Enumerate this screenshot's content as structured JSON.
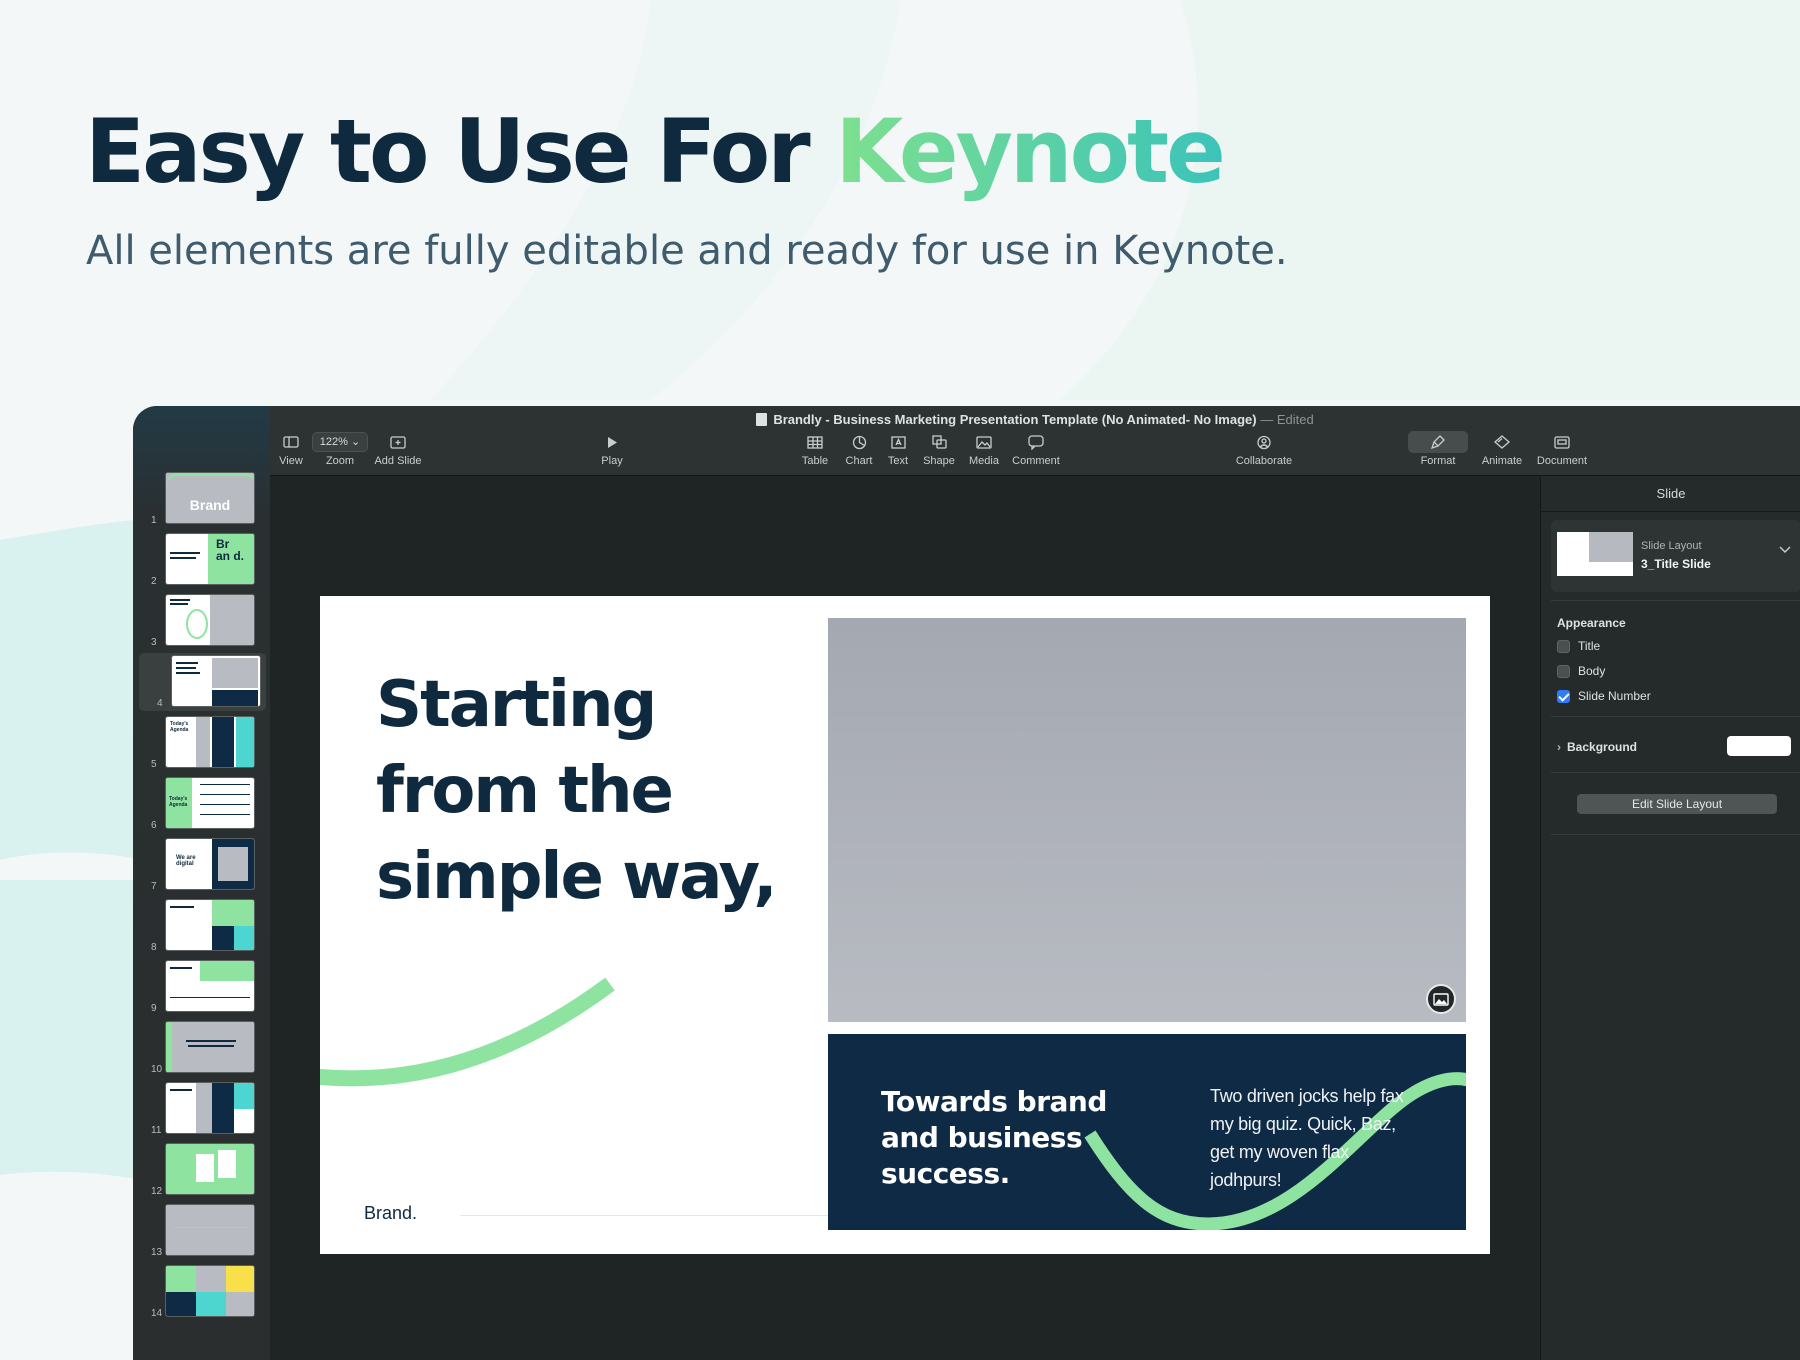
{
  "hero": {
    "title_main": "Easy to Use For ",
    "title_accent": "Keynote",
    "subtitle": "All elements are fully editable and ready for use in Keynote."
  },
  "window": {
    "doc_title": "Brandly - Business Marketing Presentation Template (No Animated- No Image)",
    "doc_status": "— Edited"
  },
  "toolbar": {
    "view": "View",
    "zoom_value": "122%",
    "zoom": "Zoom",
    "add_slide": "Add Slide",
    "play": "Play",
    "table": "Table",
    "chart": "Chart",
    "text": "Text",
    "shape": "Shape",
    "media": "Media",
    "comment": "Comment",
    "collaborate": "Collaborate",
    "format": "Format",
    "animate": "Animate",
    "document": "Document"
  },
  "navigator": {
    "slides": [
      {
        "num": "1",
        "label": "Brand"
      },
      {
        "num": "2",
        "label": "Br an d."
      },
      {
        "num": "3",
        "label": ""
      },
      {
        "num": "4",
        "label": ""
      },
      {
        "num": "5",
        "label": "Today's Agenda"
      },
      {
        "num": "6",
        "label": "Today's Agenda"
      },
      {
        "num": "7",
        "label": "We are digital"
      },
      {
        "num": "8",
        "label": ""
      },
      {
        "num": "9",
        "label": ""
      },
      {
        "num": "10",
        "label": ""
      },
      {
        "num": "11",
        "label": ""
      },
      {
        "num": "12",
        "label": ""
      },
      {
        "num": "13",
        "label": ""
      },
      {
        "num": "14",
        "label": ""
      }
    ],
    "selected": "4"
  },
  "slide": {
    "heading": "Starting from the simple way,",
    "dark_heading": "Towards brand and business success.",
    "dark_body": "Two driven jocks help fax my big quiz. Quick, Baz, get my woven flax jodhpurs!",
    "brand": "Brand."
  },
  "inspector": {
    "tab": "Slide",
    "layout_label": "Slide Layout",
    "layout_value": "3_Title Slide",
    "appearance": "Appearance",
    "title_opt": "Title",
    "body_opt": "Body",
    "slide_number_opt": "Slide Number",
    "title_checked": false,
    "body_checked": false,
    "slide_number_checked": true,
    "background": "Background",
    "edit_layout": "Edit Slide Layout"
  },
  "colors": {
    "navy": "#0f2a3f",
    "green": "#8fe3a0",
    "teal": "#3cc3b9"
  }
}
